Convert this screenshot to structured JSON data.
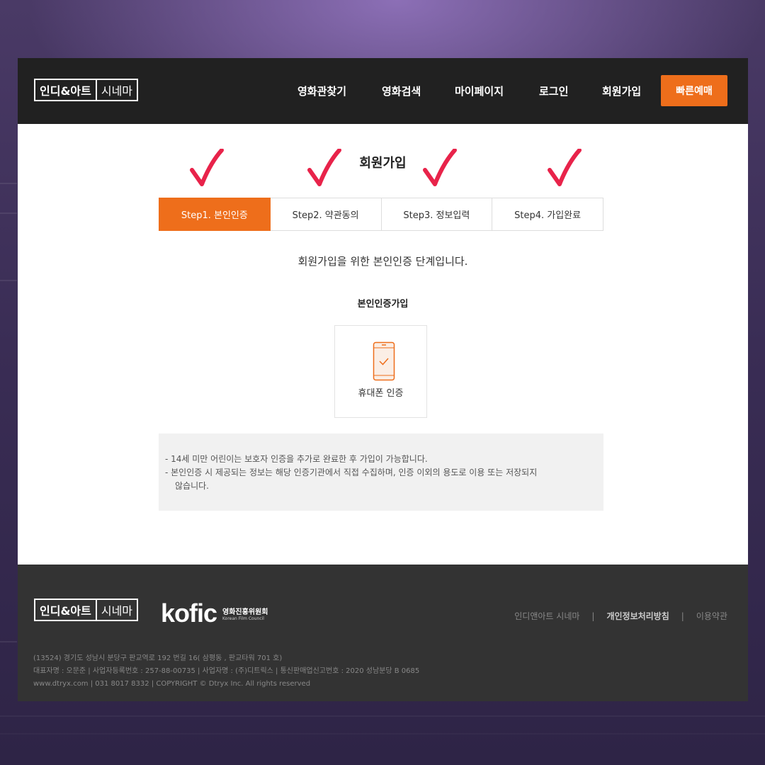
{
  "header": {
    "logo_primary": "인디&아트",
    "logo_secondary": "시네마",
    "nav": [
      "영화관찾기",
      "영화검색",
      "마이페이지",
      "로그인",
      "회원가입"
    ],
    "quick_button": "빠른예매"
  },
  "page": {
    "title": "회원가입",
    "steps": [
      "Step1. 본인인증",
      "Step2. 약관동의",
      "Step3. 정보입력",
      "Step4. 가입완료"
    ],
    "active_step": 1,
    "description": "회원가입을 위한 본인인증 단계입니다.",
    "subtitle": "본인인증가입",
    "verify_option": "휴대폰 인증",
    "notices": [
      "- 14세 미만 어린이는 보호자 인증을 추가로 완료한 후 가입이 가능합니다.",
      "- 본인인증 시 제공되는 정보는 해당 인증기관에서 직접 수집하며, 인증 이외의 용도로 이용 또는 저장되지",
      "않습니다."
    ]
  },
  "footer": {
    "kofic_mark": "kofic",
    "kofic_name": "영화진흥위원회",
    "kofic_name_en": "Korean Film Council",
    "links": [
      "인디앤아트 시네마",
      "개인정보처리방침",
      "이용약관"
    ],
    "info": [
      "(13524) 경기도 성남시 분당구 판교역로 192 번길 16( 삼평동 , 판교타워 701 호)",
      "대표자명 : 오문준 | 사업자등록번호 : 257-88-00735 | 사업자명 : (주)디트릭스 | 통신판매업신고번호 : 2020 성남분당 B 0685",
      "www.dtryx.com | 031 8017 8332 | COPYRIGHT © Dtryx Inc. All rights reserved"
    ]
  },
  "colors": {
    "accent": "#ee6e1b",
    "checkmark": "#e8234a",
    "header_bg": "#212121",
    "footer_bg": "#333333"
  },
  "icons": [
    "checkmark-icon",
    "smartphone-check-icon"
  ]
}
